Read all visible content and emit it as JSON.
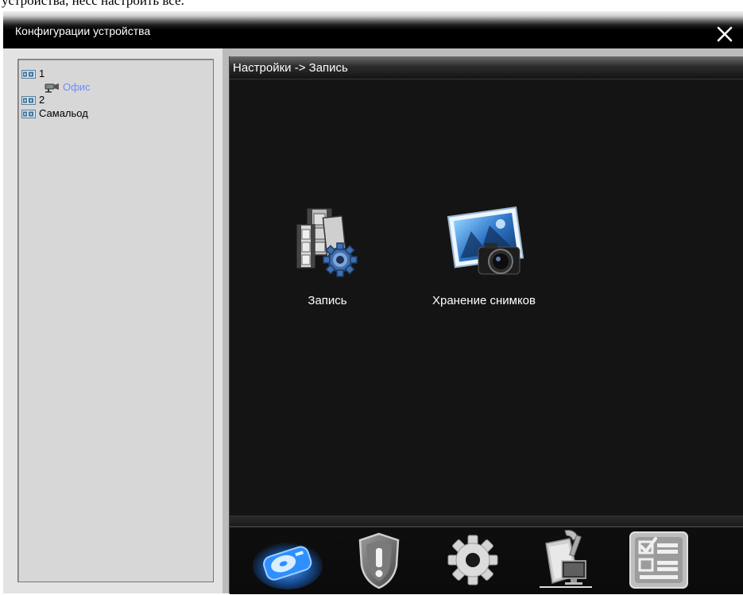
{
  "background_text": "устройства, несс настроить все.",
  "window": {
    "title": "Конфигурации устройства",
    "close_glyph": "✕"
  },
  "tree": {
    "items": [
      {
        "label": "1",
        "icon": "camera-group-icon",
        "level": 0
      },
      {
        "label": "Офис",
        "icon": "camera-icon",
        "level": 1
      },
      {
        "label": "2",
        "icon": "camera-group-icon",
        "level": 0
      },
      {
        "label": "Самальод",
        "icon": "camera-group-icon",
        "level": 0
      }
    ]
  },
  "breadcrumb": "Настройки -> Запись",
  "config_items": [
    {
      "label": "Запись",
      "icon": "film-gear-icon"
    },
    {
      "label": "Хранение снимков",
      "icon": "photo-camera-icon"
    }
  ],
  "dock": {
    "buttons": [
      {
        "icon": "storage-disk-icon",
        "active": true
      },
      {
        "icon": "alarm-shield-icon",
        "active": false
      },
      {
        "icon": "settings-gear-icon",
        "active": false
      },
      {
        "icon": "network-tools-icon",
        "active": false
      },
      {
        "icon": "checklist-icon",
        "active": false
      }
    ]
  },
  "colors": {
    "accent_active": "#1f7fff",
    "sub_item_text": "#6c8cff",
    "panel_bg": "#141414"
  }
}
